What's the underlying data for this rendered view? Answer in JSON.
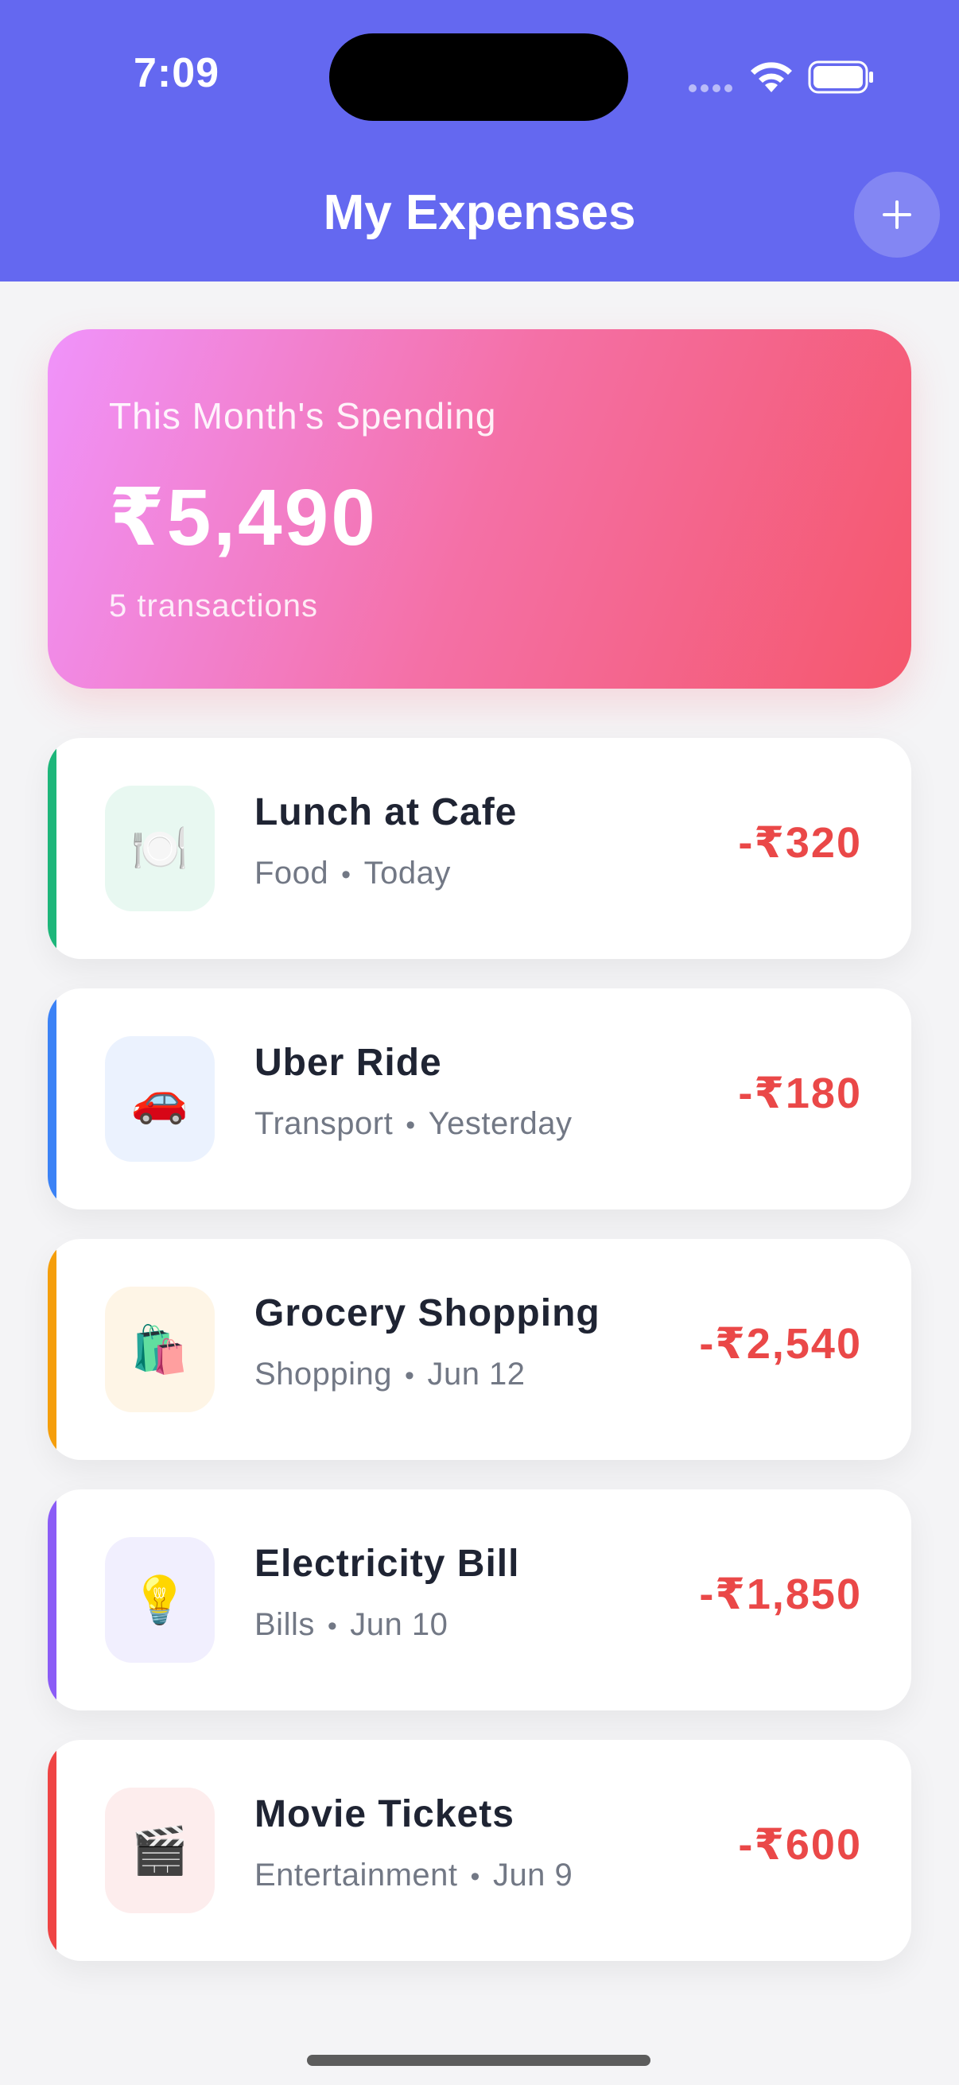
{
  "status_bar": {
    "time": "7:09"
  },
  "header": {
    "title": "My Expenses",
    "add_icon": "plus-icon"
  },
  "summary": {
    "label": "This Month's Spending",
    "amount": "₹5,490",
    "count": "5 transactions"
  },
  "transactions": [
    {
      "title": "Lunch at Cafe",
      "category": "Food",
      "date": "Today",
      "amount": "-₹320",
      "icon": "🍽️",
      "icon_name": "fork-knife-plate-icon",
      "accent": "#1db67a",
      "icon_bg": "#e8f8f1"
    },
    {
      "title": "Uber Ride",
      "category": "Transport",
      "date": "Yesterday",
      "amount": "-₹180",
      "icon": "🚗",
      "icon_name": "car-icon",
      "accent": "#3b82f6",
      "icon_bg": "#ebf2fe"
    },
    {
      "title": "Grocery Shopping",
      "category": "Shopping",
      "date": "Jun 12",
      "amount": "-₹2,540",
      "icon": "🛍️",
      "icon_name": "shopping-bags-icon",
      "accent": "#f59e0b",
      "icon_bg": "#fef5e6"
    },
    {
      "title": "Electricity Bill",
      "category": "Bills",
      "date": "Jun 10",
      "amount": "-₹1,850",
      "icon": "💡",
      "icon_name": "light-bulb-icon",
      "accent": "#8b5cf6",
      "icon_bg": "#f1effe"
    },
    {
      "title": "Movie Tickets",
      "category": "Entertainment",
      "date": "Jun 9",
      "amount": "-₹600",
      "icon": "🎬",
      "icon_name": "clapperboard-icon",
      "accent": "#ef4444",
      "icon_bg": "#fdeded"
    }
  ],
  "colors": {
    "header": "#6468f0",
    "amount_negative": "#ea4848"
  }
}
